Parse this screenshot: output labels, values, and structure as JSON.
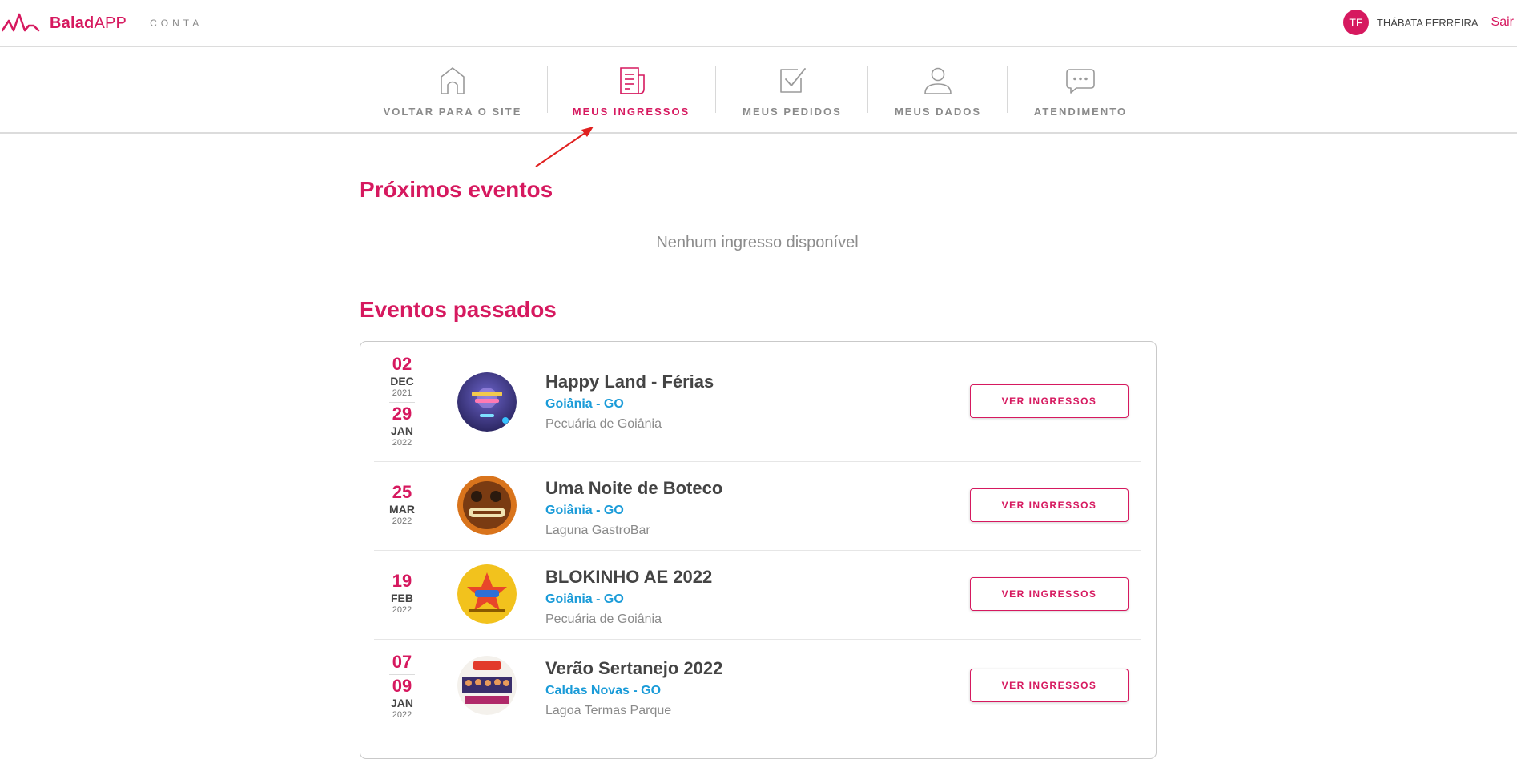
{
  "header": {
    "brand_prefix": "Balad",
    "brand_suffix": "APP",
    "subtitle": "CONTA",
    "avatar_initials": "TF",
    "user_name": "THÁBATA FERREIRA",
    "logout_label": "Sair"
  },
  "nav": {
    "items": [
      {
        "label": "VOLTAR PARA O SITE",
        "icon": "home-icon"
      },
      {
        "label": "MEUS INGRESSOS",
        "icon": "ticket-icon",
        "active": true
      },
      {
        "label": "MEUS PEDIDOS",
        "icon": "check-box-icon"
      },
      {
        "label": "MEUS DADOS",
        "icon": "user-icon"
      },
      {
        "label": "ATENDIMENTO",
        "icon": "chat-icon"
      }
    ]
  },
  "upcoming": {
    "title": "Próximos eventos",
    "empty_message": "Nenhum ingresso disponível"
  },
  "past": {
    "title": "Eventos passados",
    "button_label": "VER INGRESSOS",
    "events": [
      {
        "start": {
          "day": "02",
          "month": "DEC",
          "year": "2021"
        },
        "end": {
          "day": "29",
          "month": "JAN",
          "year": "2022"
        },
        "name": "Happy Land - Férias",
        "city": "Goiânia - GO",
        "venue": "Pecuária de Goiânia"
      },
      {
        "start": {
          "day": "25",
          "month": "MAR",
          "year": "2022"
        },
        "name": "Uma Noite de Boteco",
        "city": "Goiânia - GO",
        "venue": "Laguna GastroBar"
      },
      {
        "start": {
          "day": "19",
          "month": "FEB",
          "year": "2022"
        },
        "name": "BLOKINHO AE 2022",
        "city": "Goiânia - GO",
        "venue": "Pecuária de Goiânia"
      },
      {
        "start": {
          "day": "07"
        },
        "end": {
          "day": "09",
          "month": "JAN",
          "year": "2022"
        },
        "name": "Verão Sertanejo 2022",
        "city": "Caldas Novas - GO",
        "venue": "Lagoa Termas Parque"
      }
    ]
  },
  "colors": {
    "accent": "#d6195f",
    "link_blue": "#1a9bd8",
    "nav_gray": "#8a8a8a"
  }
}
